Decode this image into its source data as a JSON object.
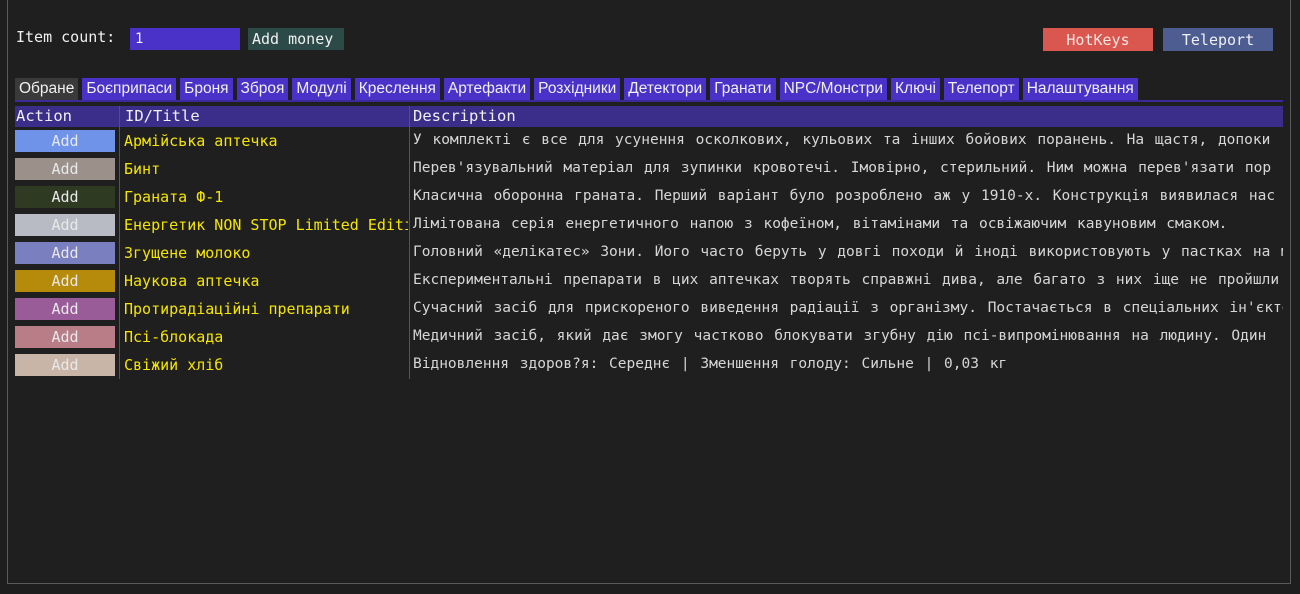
{
  "toolbar": {
    "item_count_label": "Item count:",
    "item_count_value": "1",
    "add_money_label": "Add money",
    "hotkeys_label": "HotKeys",
    "teleport_label": "Teleport"
  },
  "tabs": [
    {
      "label": "Обране",
      "active": true
    },
    {
      "label": "Боєприпаси"
    },
    {
      "label": "Броня"
    },
    {
      "label": "Зброя"
    },
    {
      "label": "Модулі"
    },
    {
      "label": "Креслення"
    },
    {
      "label": "Артефакти"
    },
    {
      "label": "Розхідники"
    },
    {
      "label": "Детектори"
    },
    {
      "label": "Гранати"
    },
    {
      "label": "NPC/Монстри"
    },
    {
      "label": "Ключі"
    },
    {
      "label": "Телепорт"
    },
    {
      "label": "Налаштування"
    }
  ],
  "table": {
    "columns": [
      "Action",
      "ID/Title",
      "Description"
    ],
    "rows": [
      {
        "action": "Add",
        "color": "#6f93e8",
        "title": "Армійська аптечка",
        "description": "У комплекті є все для усунення осколкових, кульових та інших бойових поранень. На щастя, допоки"
      },
      {
        "action": "Add",
        "color": "#9c918a",
        "title": "Бинт",
        "description": "Перев'язувальний матеріал для зупинки кровотечі. Імовірно, стерильний. Ним можна перев'язати пор"
      },
      {
        "action": "Add",
        "color": "#2f3a23",
        "title": "Граната Ф-1",
        "description": "Класична оборонна граната. Перший варіант було розроблено аж у 1910-х. Конструкція виявилася нас"
      },
      {
        "action": "Add",
        "color": "#b8bbc4",
        "title": "Енергетик NON STOP Limited Edition",
        "description": "Лімітована серія енергетичного напою з кофеїном, вітамінами та освіжаючим кавуновим смаком."
      },
      {
        "action": "Add",
        "color": "#7a7fc0",
        "title": "Згущене молоко",
        "description": "Головний «делікатес» Зони. Його часто беруть у довгі походи й іноді використовують у пастках на мут"
      },
      {
        "action": "Add",
        "color": "#b68a0a",
        "title": "Наукова аптечка",
        "description": "Експериментальні препарати в цих аптечках творять справжні дива, але багато з них іще не пройшли"
      },
      {
        "action": "Add",
        "color": "#9a5c98",
        "title": "Протирадіаційні препарати",
        "description": "Сучасний засіб для прискореного виведення радіації з організму. Постачається в спеціальних ін'єкторах"
      },
      {
        "action": "Add",
        "color": "#b87d86",
        "title": "Псі-блокада",
        "description": "Медичний засіб, який дає змогу частково блокувати згубну дію псі-випромінювання на людину. Один"
      },
      {
        "action": "Add",
        "color": "#c8b5a8",
        "title": "Свіжий хліб",
        "description": "Відновлення здоров?я: Середнє | Зменшення голоду: Сильне | 0,03 кг"
      }
    ]
  }
}
